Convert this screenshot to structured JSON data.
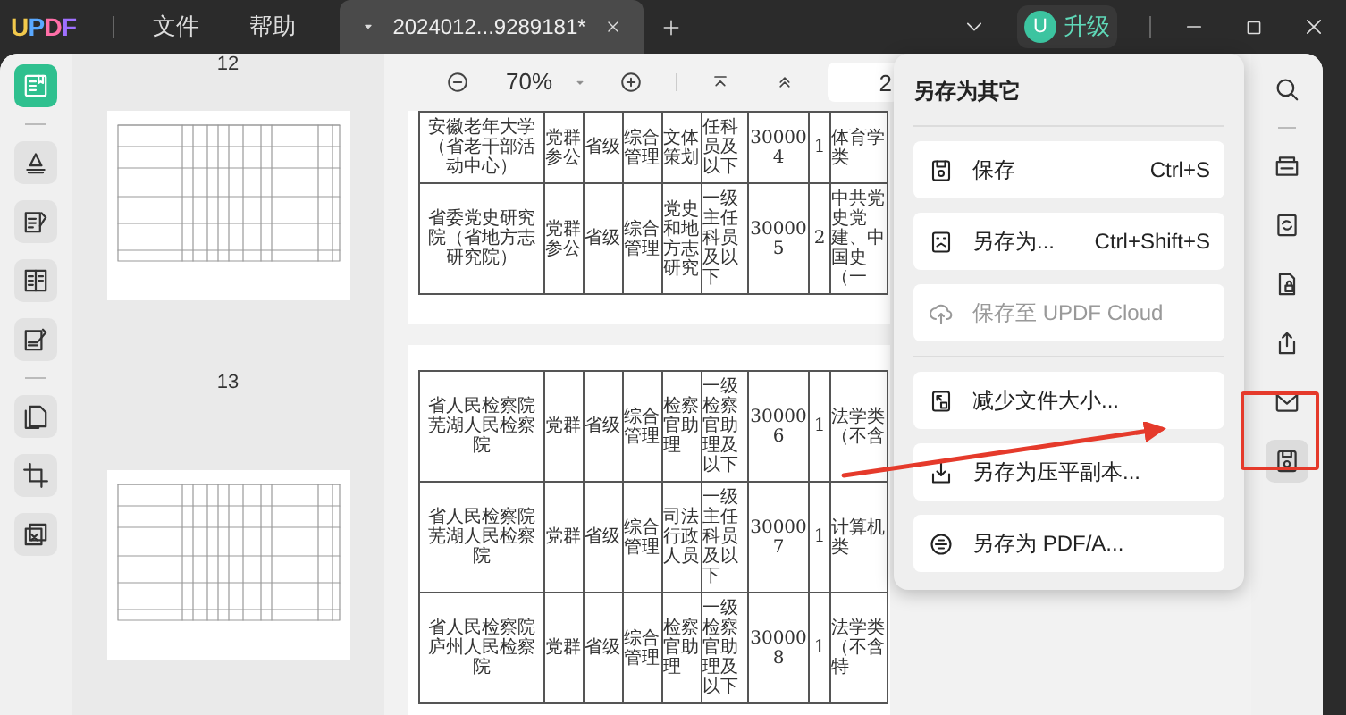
{
  "title_bar": {
    "logo": "UPDF",
    "menus": [
      {
        "label": "文件"
      },
      {
        "label": "帮助"
      }
    ],
    "tabs": [
      {
        "label": "2024012...9289181*",
        "selected": true
      }
    ],
    "avatar": "U",
    "upgrade": "升级"
  },
  "left_toolbar": {
    "tools": [
      {
        "selected": true
      },
      {
        "selected": false
      },
      {
        "selected": false
      },
      {
        "selected": false
      },
      {
        "selected": false
      },
      {
        "selected": false
      },
      {
        "selected": false
      },
      {
        "selected": false
      }
    ]
  },
  "thumbnails": [
    {
      "page": "12"
    },
    {
      "page": "13"
    }
  ],
  "zoom_bar": {
    "zoom": "70%",
    "page": "2"
  },
  "pages": [
    {
      "rows": [
        [
          "安徽老年大学（省老干部活动中心）",
          "党群参公",
          "省级",
          "综合管理",
          "文体策划",
          "任科员及以下",
          "300004",
          "1",
          "体育学类"
        ],
        [
          "省委党史研究院（省地方志研究院）",
          "党群参公",
          "省级",
          "综合管理",
          "党史和地方志研究",
          "一级主任科员及以下",
          "300005",
          "2",
          "中共党史党建、中国史（一"
        ]
      ]
    },
    {
      "rows": [
        [
          "省人民检察院芜湖人民检察院",
          "党群",
          "省级",
          "综合管理",
          "检察官助理",
          "一级检察官助理及以下",
          "300006",
          "1",
          "法学类（不含"
        ],
        [
          "省人民检察院芜湖人民检察院",
          "党群",
          "省级",
          "综合管理",
          "司法行政人员",
          "一级主任科员及以下",
          "300007",
          "1",
          "计算机类"
        ],
        [
          "省人民检察院庐州人民检察院",
          "党群",
          "省级",
          "综合管理",
          "检察官助理",
          "一级检察官助理及以下",
          "300008",
          "1",
          "法学类（不含特"
        ]
      ]
    }
  ],
  "save_menu": {
    "title": "另存为其它",
    "groups": [
      [
        {
          "label": "保存",
          "shortcut": "Ctrl+S",
          "disabled": false
        },
        {
          "label": "另存为...",
          "shortcut": "Ctrl+Shift+S",
          "disabled": false
        },
        {
          "label": "保存至 UPDF Cloud",
          "disabled": true
        }
      ],
      [
        {
          "label": "减少文件大小...",
          "disabled": false
        },
        {
          "label": "另存为压平副本...",
          "disabled": false
        },
        {
          "label": "另存为 PDF/A...",
          "disabled": false
        }
      ]
    ]
  },
  "right_toolbar": {
    "tools": [
      {
        "selected": false
      },
      {
        "selected": false
      },
      {
        "selected": false
      },
      {
        "selected": false
      },
      {
        "selected": false
      },
      {
        "selected": false
      },
      {
        "selected": true
      }
    ]
  }
}
